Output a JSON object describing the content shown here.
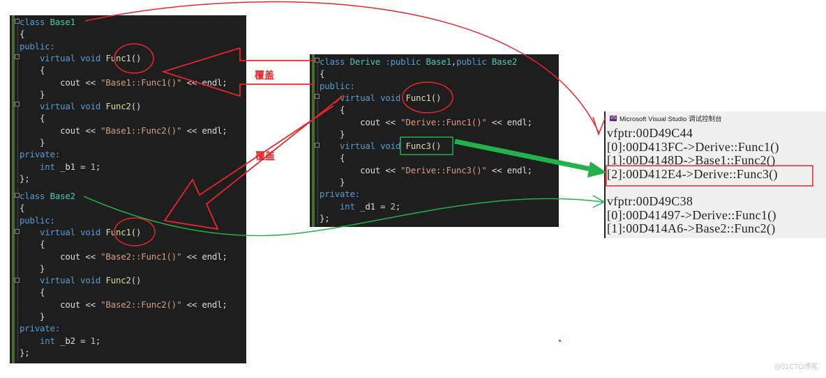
{
  "panels": {
    "base1": {
      "lines": [
        [
          [
            "kw",
            "class "
          ],
          [
            "ty",
            "Base1"
          ]
        ],
        [
          [
            "pl",
            "{"
          ]
        ],
        [
          [
            "kw",
            "public:"
          ]
        ],
        [
          [
            "pl",
            "    "
          ],
          [
            "kw",
            "virtual void "
          ],
          [
            "fn",
            "Func1"
          ],
          [
            "pl",
            "()"
          ]
        ],
        [
          [
            "pl",
            "    {"
          ]
        ],
        [
          [
            "pl",
            "        cout << "
          ],
          [
            "st",
            "\"Base1::Func1()\""
          ],
          [
            "pl",
            " << endl;"
          ]
        ],
        [
          [
            "pl",
            "    }"
          ]
        ],
        [
          [
            "pl",
            "    "
          ],
          [
            "kw",
            "virtual void "
          ],
          [
            "fn",
            "Func2"
          ],
          [
            "pl",
            "()"
          ]
        ],
        [
          [
            "pl",
            "    {"
          ]
        ],
        [
          [
            "pl",
            "        cout << "
          ],
          [
            "st",
            "\"Base1::Func2()\""
          ],
          [
            "pl",
            " << endl;"
          ]
        ],
        [
          [
            "pl",
            "    }"
          ]
        ],
        [
          [
            "kw",
            "private:"
          ]
        ],
        [
          [
            "pl",
            "    "
          ],
          [
            "kw",
            "int "
          ],
          [
            "pl",
            "_b1 = "
          ],
          [
            "nu",
            "1"
          ],
          [
            "pl",
            ";"
          ]
        ],
        [
          [
            "pl",
            "};"
          ]
        ]
      ]
    },
    "base2": {
      "lines": [
        [
          [
            "kw",
            "class "
          ],
          [
            "ty",
            "Base2"
          ]
        ],
        [
          [
            "pl",
            "{"
          ]
        ],
        [
          [
            "kw",
            "public:"
          ]
        ],
        [
          [
            "pl",
            "    "
          ],
          [
            "kw",
            "virtual void "
          ],
          [
            "fn",
            "Func1"
          ],
          [
            "pl",
            "()"
          ]
        ],
        [
          [
            "pl",
            "    {"
          ]
        ],
        [
          [
            "pl",
            "        cout << "
          ],
          [
            "st",
            "\"Base2::Func1()\""
          ],
          [
            "pl",
            " << endl;"
          ]
        ],
        [
          [
            "pl",
            "    }"
          ]
        ],
        [
          [
            "pl",
            "    "
          ],
          [
            "kw",
            "virtual void "
          ],
          [
            "fn",
            "Func2"
          ],
          [
            "pl",
            "()"
          ]
        ],
        [
          [
            "pl",
            "    {"
          ]
        ],
        [
          [
            "pl",
            "        cout << "
          ],
          [
            "st",
            "\"Base2::Func2()\""
          ],
          [
            "pl",
            " << endl;"
          ]
        ],
        [
          [
            "pl",
            "    }"
          ]
        ],
        [
          [
            "kw",
            "private:"
          ]
        ],
        [
          [
            "pl",
            "    "
          ],
          [
            "kw",
            "int "
          ],
          [
            "pl",
            "_b2 = "
          ],
          [
            "nu",
            "1"
          ],
          [
            "pl",
            ";"
          ]
        ],
        [
          [
            "pl",
            "};"
          ]
        ]
      ]
    },
    "derive": {
      "lines": [
        [
          [
            "kw",
            "class "
          ],
          [
            "ty",
            "Derive "
          ],
          [
            "kw",
            ":public "
          ],
          [
            "ty",
            "Base1"
          ],
          [
            "pl",
            ","
          ],
          [
            "kw",
            "public "
          ],
          [
            "ty",
            "Base2"
          ]
        ],
        [
          [
            "pl",
            "{"
          ]
        ],
        [
          [
            "kw",
            "public:"
          ]
        ],
        [
          [
            "pl",
            "    "
          ],
          [
            "kw",
            "virtual void "
          ],
          [
            "fn",
            "Func1"
          ],
          [
            "pl",
            "()"
          ]
        ],
        [
          [
            "pl",
            "    {"
          ]
        ],
        [
          [
            "pl",
            "        cout << "
          ],
          [
            "st",
            "\"Derive::Func1()\""
          ],
          [
            "pl",
            " << endl;"
          ]
        ],
        [
          [
            "pl",
            "    }"
          ]
        ],
        [
          [
            "pl",
            "    "
          ],
          [
            "kw",
            "virtual void "
          ],
          [
            "fn",
            "Func3"
          ],
          [
            "pl",
            "()"
          ]
        ],
        [
          [
            "pl",
            "    {"
          ]
        ],
        [
          [
            "pl",
            "        cout << "
          ],
          [
            "st",
            "\"Derive::Func3()\""
          ],
          [
            "pl",
            " << endl;"
          ]
        ],
        [
          [
            "pl",
            "    }"
          ]
        ],
        [
          [
            "kw",
            "private:"
          ]
        ],
        [
          [
            "pl",
            "    "
          ],
          [
            "kw",
            "int "
          ],
          [
            "pl",
            "_d1 = "
          ],
          [
            "nu",
            "2"
          ],
          [
            "pl",
            ";"
          ]
        ],
        [
          [
            "pl",
            "};"
          ]
        ]
      ]
    }
  },
  "console": {
    "title": "Microsoft Visual Studio 调试控制台",
    "icon": "vs-icon",
    "lines": [
      "vfptr:00D49C44",
      "[0]:00D413FC->Derive::Func1()",
      "[1]:00D4148D->Base1::Func2()",
      "[2]:00D412E4->Derive::Func3()",
      "",
      "vfptr:00D49C38",
      "[0]:00D41497->Derive::Func1()",
      "[1]:00D414A6->Base2::Func2()"
    ]
  },
  "annotations": {
    "override_label_1": "覆盖",
    "override_label_2": "覆盖"
  },
  "colors": {
    "annotation_red": "#e8262a",
    "annotation_green": "#22b14c",
    "editor_bg": "#1e1e1e",
    "console_bg": "#f0f0f0"
  },
  "watermark": "@51CTO博客"
}
